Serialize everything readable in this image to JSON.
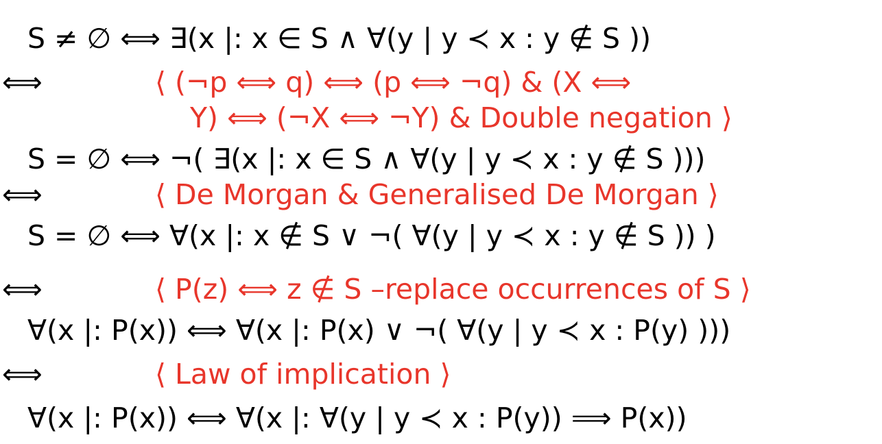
{
  "derivation": [
    {
      "kind": "formula",
      "text": "S ≠ ∅  ⟺  ∃(x |: x ∈ S  ∧  ∀(y | y ≺ x : y ∉ S ))"
    },
    {
      "kind": "step",
      "op": "⟺",
      "hint": "⟨ (¬p  ⟺  q)  ⟺  (p  ⟺  ¬q)   &    (X  ⟺"
    },
    {
      "kind": "hint-continued",
      "hint": "Y)  ⟺  (¬X  ⟺  ¬Y)   &    Double negation ⟩"
    },
    {
      "kind": "formula",
      "text": "S = ∅  ⟺  ¬( ∃(x |: x ∈ S  ∧  ∀(y | y ≺ x : y ∉ S )))"
    },
    {
      "kind": "step",
      "op": "⟺",
      "hint": "⟨ De Morgan    &    Generalised De Morgan  ⟩"
    },
    {
      "kind": "formula",
      "text": "S = ∅  ⟺  ∀(x |: x ∉ S ∨ ¬( ∀(y | y ≺ x : y ∉ S )) )"
    },
    {
      "kind": "step",
      "op": "⟺",
      "hint": "⟨ P(z)  ⟺  z ∉ S –replace occurrences of S ⟩"
    },
    {
      "kind": "formula",
      "text": "∀(x |: P(x))  ⟺  ∀(x |: P(x) ∨ ¬( ∀(y | y ≺ x : P(y) )))"
    },
    {
      "kind": "step",
      "op": "⟺",
      "hint": "⟨ Law of implication  ⟩"
    },
    {
      "kind": "formula",
      "text": "∀(x |: P(x))  ⟺  ∀(x |: ∀(y | y ≺ x : P(y))  ⟹  P(x))"
    }
  ],
  "colors": {
    "text": "#000000",
    "hint": "#e8362b",
    "background": "#ffffff"
  }
}
